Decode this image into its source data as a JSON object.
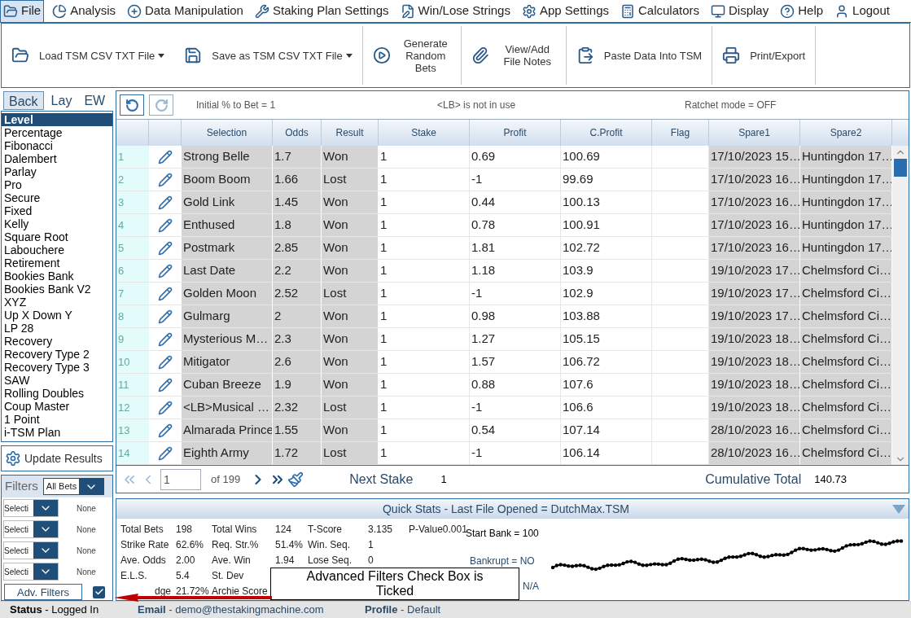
{
  "menu": [
    {
      "label": "File",
      "selected": true
    },
    {
      "label": "Analysis",
      "selected": false
    },
    {
      "label": "Data Manipulation",
      "selected": false
    },
    {
      "label": "Staking Plan Settings",
      "selected": false
    },
    {
      "label": "Win/Lose Strings",
      "selected": false
    },
    {
      "label": "App Settings",
      "selected": false
    },
    {
      "label": "Calculators",
      "selected": false
    },
    {
      "label": "Display",
      "selected": false
    },
    {
      "label": "Help",
      "selected": false
    },
    {
      "label": "Logout",
      "selected": false
    }
  ],
  "toolbar": [
    {
      "label": "Load TSM CSV TXT File",
      "dropdown": true
    },
    {
      "label": "Save as TSM CSV TXT File",
      "dropdown": true
    },
    {
      "label": "Generate Random Bets",
      "dropdown": false
    },
    {
      "label": "View/Add File Notes",
      "dropdown": false
    },
    {
      "label": "Paste Data Into TSM",
      "dropdown": false
    },
    {
      "label": "Print/Export",
      "dropdown": false
    }
  ],
  "bet_tabs": [
    {
      "label": "Back",
      "selected": true
    },
    {
      "label": "Lay",
      "selected": false
    },
    {
      "label": "EW",
      "selected": false
    }
  ],
  "plans": [
    {
      "label": "Level",
      "selected": true
    },
    {
      "label": "Percentage",
      "selected": false
    },
    {
      "label": "Fibonacci",
      "selected": false
    },
    {
      "label": "Dalembert",
      "selected": false
    },
    {
      "label": "Parlay",
      "selected": false
    },
    {
      "label": "Pro",
      "selected": false
    },
    {
      "label": "Secure",
      "selected": false
    },
    {
      "label": "Fixed",
      "selected": false
    },
    {
      "label": "Kelly",
      "selected": false
    },
    {
      "label": "Square Root",
      "selected": false
    },
    {
      "label": "Labouchere",
      "selected": false
    },
    {
      "label": "Retirement",
      "selected": false
    },
    {
      "label": "Bookies Bank",
      "selected": false
    },
    {
      "label": "Bookies Bank V2",
      "selected": false
    },
    {
      "label": "XYZ",
      "selected": false
    },
    {
      "label": "Up X Down Y",
      "selected": false
    },
    {
      "label": "LP 28",
      "selected": false
    },
    {
      "label": "Recovery",
      "selected": false
    },
    {
      "label": "Recovery Type 2",
      "selected": false
    },
    {
      "label": "Recovery Type 3",
      "selected": false
    },
    {
      "label": "SAW",
      "selected": false
    },
    {
      "label": "Rolling Doubles",
      "selected": false
    },
    {
      "label": "Coup Master",
      "selected": false
    },
    {
      "label": "1 Point",
      "selected": false
    },
    {
      "label": "i-TSM Plan",
      "selected": false
    }
  ],
  "update_button": "Update Results",
  "filters": {
    "label": "Filters",
    "value": "All Bets",
    "rows": [
      {
        "select": "Selecti",
        "value": "None"
      },
      {
        "select": "Selecti",
        "value": "None"
      },
      {
        "select": "Selecti",
        "value": "None"
      },
      {
        "select": "Selecti",
        "value": "None"
      }
    ],
    "adv_button": "Adv. Filters",
    "adv_checked": true
  },
  "info": [
    "Initial % to Bet = 1",
    "<LB> is not in use",
    "Ratchet mode = OFF"
  ],
  "table": {
    "columns": [
      "Selection",
      "Odds",
      "Result",
      "Stake",
      "Profit",
      "C.Profit",
      "Flag",
      "Spare1",
      "Spare2"
    ],
    "rows": [
      {
        "n": "1",
        "selection": "Strong Belle",
        "odds": "1.7",
        "result": "Won",
        "stake": "1",
        "profit": "0.69",
        "cprofit": "100.69",
        "spare1": "17/10/2023 15…",
        "spare2": "Huntingdon 17…"
      },
      {
        "n": "2",
        "selection": "Boom Boom",
        "odds": "1.66",
        "result": "Lost",
        "stake": "1",
        "profit": "-1",
        "cprofit": "99.69",
        "spare1": "17/10/2023 16…",
        "spare2": "Huntingdon 17…"
      },
      {
        "n": "3",
        "selection": "Gold Link",
        "odds": "1.45",
        "result": "Won",
        "stake": "1",
        "profit": "0.44",
        "cprofit": "100.13",
        "spare1": "17/10/2023 16…",
        "spare2": "Huntingdon 17…"
      },
      {
        "n": "4",
        "selection": "Enthused",
        "odds": "1.8",
        "result": "Won",
        "stake": "1",
        "profit": "0.78",
        "cprofit": "100.91",
        "spare1": "17/10/2023 16…",
        "spare2": "Huntingdon 17…"
      },
      {
        "n": "5",
        "selection": "Postmark",
        "odds": "2.85",
        "result": "Won",
        "stake": "1",
        "profit": "1.81",
        "cprofit": "102.72",
        "spare1": "17/10/2023 16…",
        "spare2": "Huntingdon 17…"
      },
      {
        "n": "6",
        "selection": "Last Date",
        "odds": "2.2",
        "result": "Won",
        "stake": "1",
        "profit": "1.18",
        "cprofit": "103.9",
        "spare1": "19/10/2023 17…",
        "spare2": "Chelmsford Ci…"
      },
      {
        "n": "7",
        "selection": "Golden Moon",
        "odds": "2.52",
        "result": "Lost",
        "stake": "1",
        "profit": "-1",
        "cprofit": "102.9",
        "spare1": "19/10/2023 17…",
        "spare2": "Chelmsford Ci…"
      },
      {
        "n": "8",
        "selection": "Gulmarg",
        "odds": "2",
        "result": "Won",
        "stake": "1",
        "profit": "0.98",
        "cprofit": "103.88",
        "spare1": "19/10/2023 17…",
        "spare2": "Chelmsford Ci…"
      },
      {
        "n": "9",
        "selection": "Mysterious M…",
        "odds": "2.3",
        "result": "Won",
        "stake": "1",
        "profit": "1.27",
        "cprofit": "105.15",
        "spare1": "19/10/2023 18…",
        "spare2": "Chelmsford Ci…"
      },
      {
        "n": "10",
        "selection": "Mitigator",
        "odds": "2.6",
        "result": "Won",
        "stake": "1",
        "profit": "1.57",
        "cprofit": "106.72",
        "spare1": "19/10/2023 18…",
        "spare2": "Chelmsford Ci…"
      },
      {
        "n": "11",
        "selection": "Cuban Breeze",
        "odds": "1.9",
        "result": "Won",
        "stake": "1",
        "profit": "0.88",
        "cprofit": "107.6",
        "spare1": "19/10/2023 18…",
        "spare2": "Chelmsford Ci…"
      },
      {
        "n": "12",
        "selection": "<LB>Musical …",
        "odds": "2.32",
        "result": "Lost",
        "stake": "1",
        "profit": "-1",
        "cprofit": "106.6",
        "spare1": "19/10/2023 18…",
        "spare2": "Chelmsford Ci…"
      },
      {
        "n": "13",
        "selection": "Almarada Prince",
        "odds": "1.55",
        "result": "Won",
        "stake": "1",
        "profit": "0.54",
        "cprofit": "107.14",
        "spare1": "28/10/2023 16…",
        "spare2": "Chelmsford Ci…"
      },
      {
        "n": "14",
        "selection": "Eighth Army",
        "odds": "1.72",
        "result": "Lost",
        "stake": "1",
        "profit": "-1",
        "cprofit": "106.14",
        "spare1": "28/10/2023 16…",
        "spare2": "Chelmsford Ci…"
      }
    ]
  },
  "pager": {
    "page": "1",
    "of": "of 199",
    "next_label": "Next Stake",
    "next_value": "1",
    "cum_label": "Cumulative Total",
    "cum_value": "140.73"
  },
  "quick_stats": {
    "title": "Quick Stats - Last File Opened = DutchMax.TSM",
    "rows": [
      [
        {
          "label": "Total Bets",
          "value": "198"
        },
        {
          "label": "Total Wins",
          "value": "124"
        },
        {
          "label": "T-Score",
          "value": "3.135"
        },
        {
          "label": "P-Value",
          "value": "0.001"
        }
      ],
      [
        {
          "label": "Strike Rate",
          "value": "62.6%"
        },
        {
          "label": "Req. Str.%",
          "value": "51.4%"
        },
        {
          "label": "Win. Seq.",
          "value": "1"
        }
      ],
      [
        {
          "label": "Ave. Odds",
          "value": "2.00"
        },
        {
          "label": "Ave. Win",
          "value": "1.94"
        },
        {
          "label": "Lose Seq.",
          "value": "0"
        }
      ],
      [
        {
          "label": "E.L.S.",
          "value": "5.4"
        },
        {
          "label": "St. Dev"
        }
      ],
      [
        {
          "label": "dge",
          "value": "21.72%"
        },
        {
          "label": "Archie Score"
        }
      ]
    ],
    "start_bank": "Start Bank = 100",
    "bankrupt": "Bankrupt = NO",
    "na": "N/A"
  },
  "callout": "Advanced Filters Check Box is Ticked",
  "status": [
    {
      "text": "**Status** - Logged In"
    },
    {
      "text": "**Email** - demo@thestakingmachine.com"
    },
    {
      "text": "**Profile** - Default"
    }
  ]
}
